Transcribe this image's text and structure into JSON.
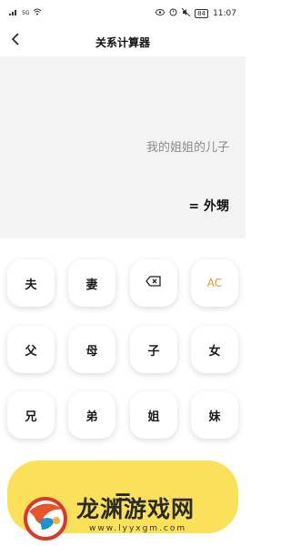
{
  "status_bar": {
    "network_label": "5G",
    "battery": "84",
    "time": "11:07"
  },
  "nav": {
    "title": "关系计算器",
    "back_icon": "chevron-left-icon"
  },
  "display": {
    "expression": "我的姐姐的儿子",
    "result": "= 外甥"
  },
  "keys": {
    "husband": "夫",
    "wife": "妻",
    "clear": "AC",
    "father": "父",
    "mother": "母",
    "son": "子",
    "daughter": "女",
    "elder_brother": "兄",
    "younger_brother": "弟",
    "elder_sister": "姐",
    "younger_sister": "妹"
  },
  "equals": "=",
  "watermark": {
    "title": "龙渊游戏网",
    "url": "www.lyyxgm.com"
  },
  "colors": {
    "accent_yellow": "#fbe15a",
    "ac_orange": "#e89a2a",
    "display_bg": "#f3f3f3"
  }
}
